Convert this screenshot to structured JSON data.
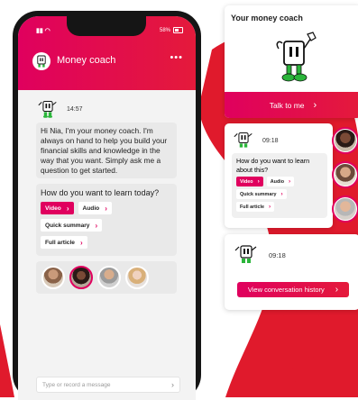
{
  "phone": {
    "status_time": "",
    "battery": "58%",
    "app_title": "Money coach",
    "menu_glyph": "•••",
    "chat": {
      "coach_time": "14:57",
      "intro_message": "Hi Nia, I'm your money coach. I'm always on hand to help you build your financial skills and knowledge in the way that you want. Simply ask me a question to get started.",
      "question": "How do you want to learn today?",
      "options": [
        {
          "label": "Video",
          "selected": true
        },
        {
          "label": "Audio",
          "selected": false
        },
        {
          "label": "Quick summary",
          "selected": false
        },
        {
          "label": "Full article",
          "selected": false
        }
      ],
      "chevron": "›"
    },
    "input_placeholder": "Type or record a message",
    "input_chevron": "›"
  },
  "coach_card": {
    "title": "Your money coach",
    "talk_button": "Talk to me",
    "chevron": "›"
  },
  "mini_chat_card": {
    "time": "09:18",
    "question": "How do you want to learn about this?",
    "options": [
      {
        "label": "Video",
        "selected": true
      },
      {
        "label": "Audio",
        "selected": false
      },
      {
        "label": "Quick summary",
        "selected": false
      },
      {
        "label": "Full article",
        "selected": false
      }
    ],
    "chevron": "›"
  },
  "history_card": {
    "time": "09:18",
    "button": "View conversation history",
    "chevron": "›"
  },
  "colors": {
    "brand_pink": "#e0005e",
    "brand_red": "#e41a3b",
    "bubble_grey": "#e9e9e9",
    "character_green": "#2ab53a"
  },
  "icons": [
    "coach-character-icon",
    "chevron-right-icon",
    "battery-icon",
    "more-icon",
    "advisor-avatar"
  ]
}
